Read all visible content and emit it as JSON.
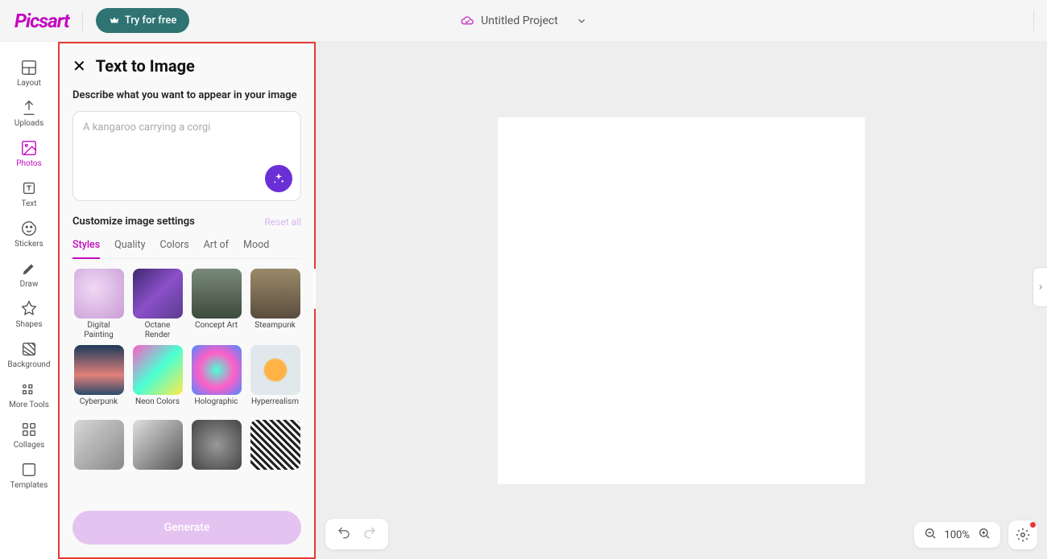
{
  "header": {
    "logo": "Picsart",
    "try_button": "Try for free",
    "project_name": "Untitled Project"
  },
  "sidebar": {
    "items": [
      {
        "label": "Layout"
      },
      {
        "label": "Uploads"
      },
      {
        "label": "Photos"
      },
      {
        "label": "Text"
      },
      {
        "label": "Stickers"
      },
      {
        "label": "Draw"
      },
      {
        "label": "Shapes"
      },
      {
        "label": "Background"
      },
      {
        "label": "More Tools"
      },
      {
        "label": "Collages"
      },
      {
        "label": "Templates"
      }
    ]
  },
  "panel": {
    "title": "Text to Image",
    "describe_label": "Describe what you want to appear in your image",
    "prompt_placeholder": "A kangaroo carrying a corgi",
    "customize_label": "Customize image settings",
    "reset_label": "Reset all",
    "tabs": [
      "Styles",
      "Quality",
      "Colors",
      "Art of",
      "Mood"
    ],
    "active_tab": "Styles",
    "styles": [
      {
        "label": "Digital Painting"
      },
      {
        "label": "Octane Render"
      },
      {
        "label": "Concept Art"
      },
      {
        "label": "Steampunk"
      },
      {
        "label": "Cyberpunk"
      },
      {
        "label": "Neon Colors"
      },
      {
        "label": "Holographic"
      },
      {
        "label": "Hyperrealism"
      },
      {
        "label": ""
      },
      {
        "label": ""
      },
      {
        "label": ""
      },
      {
        "label": ""
      }
    ],
    "generate_label": "Generate"
  },
  "toolbar": {
    "zoom_value": "100%"
  }
}
